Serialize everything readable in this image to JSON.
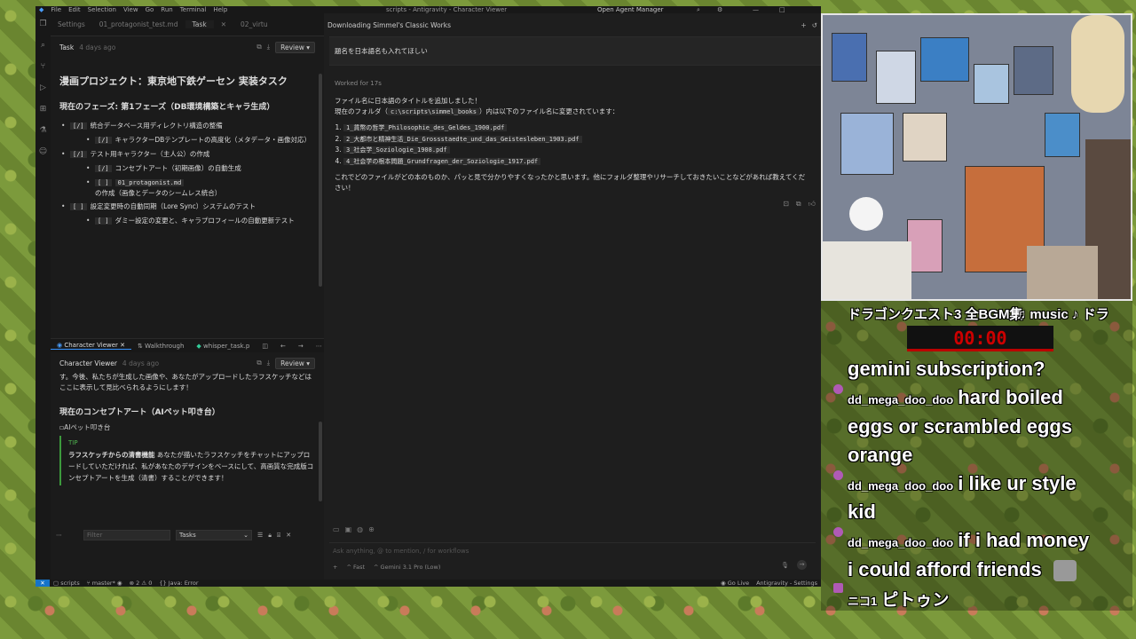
{
  "window": {
    "menus": [
      "File",
      "Edit",
      "Selection",
      "View",
      "Go",
      "Run",
      "Terminal",
      "Help"
    ],
    "title": "scripts - Antigravity - Character Viewer",
    "open_agent_manager": "Open Agent Manager"
  },
  "left_tabs": [
    "Settings",
    "01_protagonist_test.md",
    "Task",
    "02_virtu"
  ],
  "task_panel": {
    "name": "Task",
    "time": "4 days ago",
    "review_label": "Review",
    "title": "漫画プロジェクト：東京地下鉄ゲーセン 実装タスク",
    "phase_heading": "現在のフェーズ: 第1フェーズ（DB環境構築とキャラ生成）",
    "items": [
      {
        "check": "[/]",
        "text": "統合データベース用ディレクトリ構造の整備",
        "sub": [
          {
            "check": "[/]",
            "text": "キャラクターDBテンプレートの高度化（メタデータ・画像対応）"
          }
        ]
      },
      {
        "check": "[/]",
        "text": "テスト用キャラクター（主人公）の作成",
        "sub": [
          {
            "check": "[/]",
            "text": "コンセプトアート（初期画像）の自動生成"
          },
          {
            "check": "[ ]",
            "code": "01_protagonist.md",
            "text": "の作成（画像とデータのシームレス統合）"
          }
        ]
      },
      {
        "check": "[ ]",
        "text": "設定変更時の自動同期（Lore Sync）システムのテスト",
        "sub": [
          {
            "check": "[ ]",
            "text": "ダミー設定の変更と、キャラプロフィールの自動更新テスト"
          }
        ]
      }
    ]
  },
  "bottom_tabs": [
    "Character Viewer",
    "Walkthrough",
    "whisper_task.p"
  ],
  "character_viewer": {
    "name": "Character Viewer",
    "time": "4 days ago",
    "review_label": "Review",
    "intro": "す。今後、私たちが生成した画像や、あなたがアップロードしたラフスケッチなどはここに表示して見比べられるようにします！",
    "heading": "現在のコンセプトアート（AIペット叩き台）",
    "image_alt": "AIペット叩き台",
    "tip_label": "TIP",
    "tip_bold": "ラフスケッチからの清書機能",
    "tip_text": " あなたが描いたラフスケッチをチャットにアップロードしていただければ、私があなたのデザインをベースにして、高画質な完成版コンセプトアートを生成（清書）することができます！"
  },
  "filter_bar": {
    "filter_placeholder": "Filter",
    "select_value": "Tasks"
  },
  "chat": {
    "header": "Downloading Simmel's Classic Works",
    "user_message": "題名を日本語名も入れてほしい",
    "worked_for": "Worked for 17s",
    "line1": "ファイル名に日本語のタイトルを追加しました！",
    "line2_pre": "現在のフォルダ（",
    "line2_code": "c:\\scripts\\simmel_books",
    "line2_post": "）内は以下のファイル名に変更されています：",
    "files": [
      "1_貨幣の哲学_Philosophie_des_Geldes_1900.pdf",
      "2_大都市と精神生活_Die_Grossstaedte_und_das_Geistesleben_1903.pdf",
      "3_社会学_Soziologie_1908.pdf",
      "4_社会学の根本問題_Grundfragen_der_Soziologie_1917.pdf"
    ],
    "closing": "これでどのファイルがどの本のものか、パッと見で分かりやすくなったかと思います。他にフォルダ整理やリサーチしておきたいことなどがあれば教えてください！",
    "input_placeholder": "Ask anything, @ to mention, / for workflows",
    "mode_label": "Fast",
    "model_label": "Gemini 3.1 Pro (Low)"
  },
  "statusbar": {
    "folder": "scripts",
    "branch": "master*",
    "errors": "2",
    "warnings": "0",
    "java": "Java: Error",
    "go_live": "Go Live",
    "antigravity": "Antigravity - Settings"
  },
  "stream": {
    "now_playing": "ドラゴンクエスト3 全BGM集",
    "music_tag": "♫ music ♪ ドラ",
    "timer": "00:00",
    "messages": [
      {
        "user": "",
        "text": "gemini subscription?"
      },
      {
        "user": "dd_mega_doo_doo",
        "text": "hard boiled"
      },
      {
        "user": "",
        "text": "eggs or scrambled eggs"
      },
      {
        "user": "",
        "text": "orange"
      },
      {
        "user": "dd_mega_doo_doo",
        "text": "i like ur style"
      },
      {
        "user": "",
        "text": "kid"
      },
      {
        "user": "dd_mega_doo_doo",
        "text": "if i had money"
      },
      {
        "user": "",
        "text": "i could afford friends"
      },
      {
        "user": "ニコ1",
        "text": "ピトゥン"
      }
    ]
  }
}
